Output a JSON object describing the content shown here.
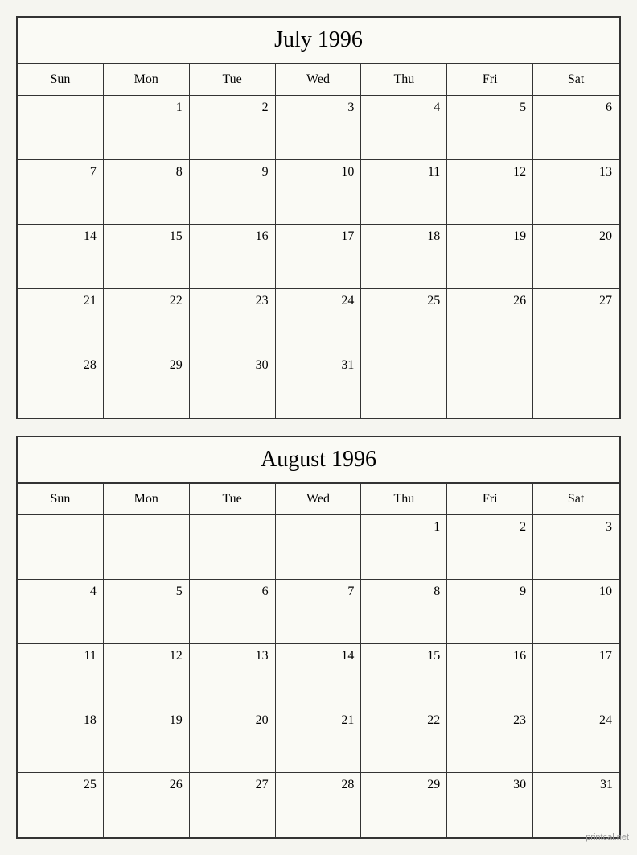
{
  "calendars": [
    {
      "id": "july-1996",
      "title": "July 1996",
      "headers": [
        "Sun",
        "Mon",
        "Tue",
        "Wed",
        "Thu",
        "Fri",
        "Sat"
      ],
      "weeks": [
        [
          {
            "day": "",
            "empty": true
          },
          {
            "day": "1",
            "empty": false
          },
          {
            "day": "2",
            "empty": false
          },
          {
            "day": "3",
            "empty": false
          },
          {
            "day": "4",
            "empty": false
          },
          {
            "day": "5",
            "empty": false
          },
          {
            "day": "6",
            "empty": false
          }
        ],
        [
          {
            "day": "7",
            "empty": false
          },
          {
            "day": "8",
            "empty": false
          },
          {
            "day": "9",
            "empty": false
          },
          {
            "day": "10",
            "empty": false
          },
          {
            "day": "11",
            "empty": false
          },
          {
            "day": "12",
            "empty": false
          },
          {
            "day": "13",
            "empty": false
          }
        ],
        [
          {
            "day": "14",
            "empty": false
          },
          {
            "day": "15",
            "empty": false
          },
          {
            "day": "16",
            "empty": false
          },
          {
            "day": "17",
            "empty": false
          },
          {
            "day": "18",
            "empty": false
          },
          {
            "day": "19",
            "empty": false
          },
          {
            "day": "20",
            "empty": false
          }
        ],
        [
          {
            "day": "21",
            "empty": false
          },
          {
            "day": "22",
            "empty": false
          },
          {
            "day": "23",
            "empty": false
          },
          {
            "day": "24",
            "empty": false
          },
          {
            "day": "25",
            "empty": false
          },
          {
            "day": "26",
            "empty": false
          },
          {
            "day": "27",
            "empty": false
          }
        ],
        [
          {
            "day": "28",
            "empty": false
          },
          {
            "day": "29",
            "empty": false
          },
          {
            "day": "30",
            "empty": false
          },
          {
            "day": "31",
            "empty": false
          },
          {
            "day": "",
            "empty": true
          },
          {
            "day": "",
            "empty": true
          },
          {
            "day": "",
            "empty": true
          }
        ]
      ]
    },
    {
      "id": "august-1996",
      "title": "August 1996",
      "headers": [
        "Sun",
        "Mon",
        "Tue",
        "Wed",
        "Thu",
        "Fri",
        "Sat"
      ],
      "weeks": [
        [
          {
            "day": "",
            "empty": true
          },
          {
            "day": "",
            "empty": true
          },
          {
            "day": "",
            "empty": true
          },
          {
            "day": "",
            "empty": true
          },
          {
            "day": "1",
            "empty": false
          },
          {
            "day": "2",
            "empty": false
          },
          {
            "day": "3",
            "empty": false
          }
        ],
        [
          {
            "day": "4",
            "empty": false
          },
          {
            "day": "5",
            "empty": false
          },
          {
            "day": "6",
            "empty": false
          },
          {
            "day": "7",
            "empty": false
          },
          {
            "day": "8",
            "empty": false
          },
          {
            "day": "9",
            "empty": false
          },
          {
            "day": "10",
            "empty": false
          }
        ],
        [
          {
            "day": "11",
            "empty": false
          },
          {
            "day": "12",
            "empty": false
          },
          {
            "day": "13",
            "empty": false
          },
          {
            "day": "14",
            "empty": false
          },
          {
            "day": "15",
            "empty": false
          },
          {
            "day": "16",
            "empty": false
          },
          {
            "day": "17",
            "empty": false
          }
        ],
        [
          {
            "day": "18",
            "empty": false
          },
          {
            "day": "19",
            "empty": false
          },
          {
            "day": "20",
            "empty": false
          },
          {
            "day": "21",
            "empty": false
          },
          {
            "day": "22",
            "empty": false
          },
          {
            "day": "23",
            "empty": false
          },
          {
            "day": "24",
            "empty": false
          }
        ],
        [
          {
            "day": "25",
            "empty": false
          },
          {
            "day": "26",
            "empty": false
          },
          {
            "day": "27",
            "empty": false
          },
          {
            "day": "28",
            "empty": false
          },
          {
            "day": "29",
            "empty": false
          },
          {
            "day": "30",
            "empty": false
          },
          {
            "day": "31",
            "empty": false
          }
        ]
      ]
    }
  ],
  "watermark": "printcal.net"
}
